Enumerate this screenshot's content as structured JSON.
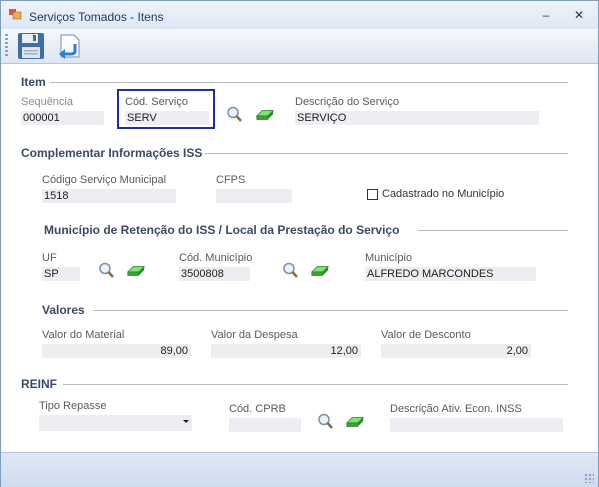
{
  "window": {
    "title": "Serviços Tomados - Itens",
    "minimize": "–",
    "close": "✕"
  },
  "toolbar": {
    "save_icon": "floppy-disk-icon",
    "back_icon": "return-arrow-icon"
  },
  "item": {
    "section": "Item",
    "sequencia_label": "Sequência",
    "sequencia_value": "000001",
    "cod_servico_label": "Cód. Serviço",
    "cod_servico_value": "SERV",
    "descricao_label": "Descrição do Serviço",
    "descricao_value": "SERVIÇO"
  },
  "iss": {
    "section": "Complementar Informações ISS",
    "cod_municipal_label": "Código Serviço Municipal",
    "cod_municipal_value": "1518",
    "cfps_label": "CFPS",
    "cfps_value": "",
    "cadastrado_label": "Cadastrado no Município",
    "cadastrado_checked": false
  },
  "municipio": {
    "section": "Município de Retenção do ISS / Local da Prestação  do Serviço",
    "uf_label": "UF",
    "uf_value": "SP",
    "cod_municipio_label": "Cód. Município",
    "cod_municipio_value": "3500808",
    "municipio_label": "Município",
    "municipio_value": "ALFREDO MARCONDES"
  },
  "valores": {
    "section": "Valores",
    "material_label": "Valor do Material",
    "material_value": "89,00",
    "despesa_label": "Valor da Despesa",
    "despesa_value": "12,00",
    "desconto_label": "Valor de Desconto",
    "desconto_value": "2,00"
  },
  "reinf": {
    "section": "REINF",
    "tipo_repasse_label": "Tipo Repasse",
    "tipo_repasse_value": "",
    "cod_cprb_label": "Cód. CPRB",
    "cod_cprb_value": "",
    "descricao_ativ_label": "Descrição Ativ. Econ. INSS",
    "descricao_ativ_value": ""
  },
  "colors": {
    "focus_border": "#1c2fa8",
    "section_text": "#3a4a63",
    "field_bg": "#eceef1"
  }
}
